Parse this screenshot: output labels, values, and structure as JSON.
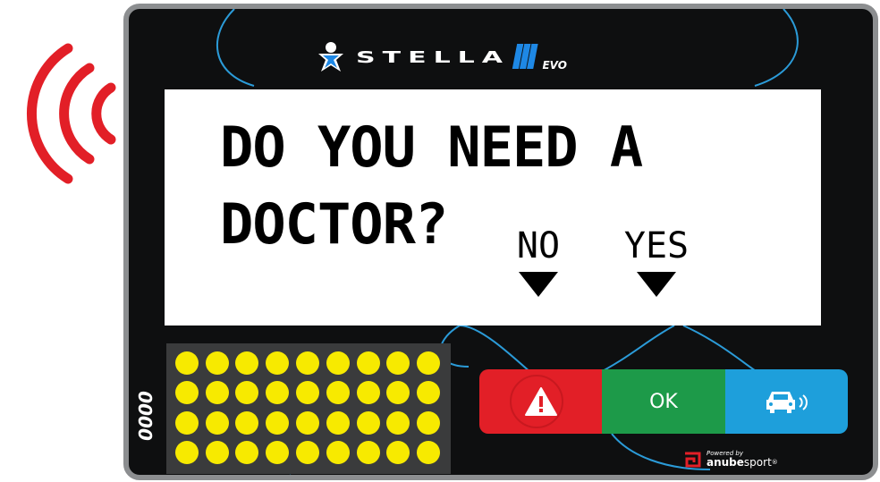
{
  "header": {
    "brand": "STELLA",
    "brand_version": "III",
    "brand_suffix": "EVO"
  },
  "screen": {
    "message_line1": "DO YOU NEED A",
    "message_line2": "DOCTOR?",
    "option_no": "NO",
    "option_yes": "YES"
  },
  "counter": "0000",
  "buttons": {
    "alert_icon": "warning-icon",
    "ok_label": "OK",
    "car_icon": "car-signal-icon"
  },
  "footer": {
    "powered_by": "Powered by",
    "brand_bold": "anube",
    "brand_rest": "sport",
    "trademark": "®"
  },
  "icons": {
    "signal": "signal-waves-icon",
    "logo": "stella-figure-icon"
  },
  "colors": {
    "signal": "#e21f27",
    "alert": "#e21f27",
    "ok": "#1d9a49",
    "car": "#1e9fdb",
    "accent": "#1e88e5",
    "leds": "#f7ea00"
  },
  "led_matrix": {
    "rows": 4,
    "cols": 9,
    "lit": "all"
  }
}
